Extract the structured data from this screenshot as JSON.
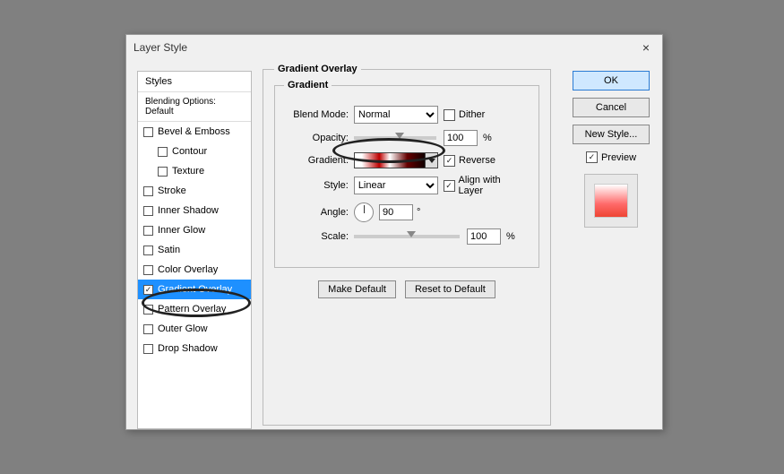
{
  "title": "Layer Style",
  "sidebar": {
    "header": "Styles",
    "blending": "Blending Options: Default",
    "items": [
      {
        "label": "Bevel & Emboss",
        "checked": false
      },
      {
        "label": "Contour",
        "checked": false,
        "indent": true
      },
      {
        "label": "Texture",
        "checked": false,
        "indent": true
      },
      {
        "label": "Stroke",
        "checked": false
      },
      {
        "label": "Inner Shadow",
        "checked": false
      },
      {
        "label": "Inner Glow",
        "checked": false
      },
      {
        "label": "Satin",
        "checked": false
      },
      {
        "label": "Color Overlay",
        "checked": false
      },
      {
        "label": "Gradient Overlay",
        "checked": true,
        "selected": true
      },
      {
        "label": "Pattern Overlay",
        "checked": false
      },
      {
        "label": "Outer Glow",
        "checked": false
      },
      {
        "label": "Drop Shadow",
        "checked": false
      }
    ]
  },
  "panel": {
    "legend": "Gradient Overlay",
    "inner_legend": "Gradient",
    "blend_mode_label": "Blend Mode:",
    "blend_mode_value": "Normal",
    "dither_label": "Dither",
    "opacity_label": "Opacity:",
    "opacity_value": "100",
    "percent": "%",
    "gradient_label": "Gradient:",
    "reverse_label": "Reverse",
    "style_label": "Style:",
    "style_value": "Linear",
    "align_label": "Align with Layer",
    "angle_label": "Angle:",
    "angle_value": "90",
    "degree": "°",
    "scale_label": "Scale:",
    "scale_value": "100",
    "make_default": "Make Default",
    "reset_default": "Reset to Default"
  },
  "right": {
    "ok": "OK",
    "cancel": "Cancel",
    "new_style": "New Style...",
    "preview": "Preview"
  }
}
